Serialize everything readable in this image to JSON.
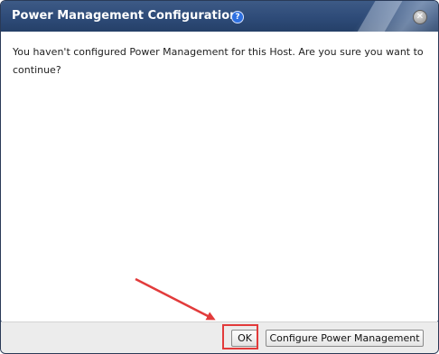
{
  "dialog": {
    "title": "Power Management Configuration",
    "help_icon": "help-icon",
    "help_glyph": "?",
    "close_icon": "close-icon",
    "close_glyph": "✕",
    "message": "You haven't configured Power Management for this Host. Are you sure you want to continue?"
  },
  "footer": {
    "ok_label": "OK",
    "configure_label": "Configure Power Management"
  },
  "annotation": {
    "color": "#e23b3b"
  }
}
